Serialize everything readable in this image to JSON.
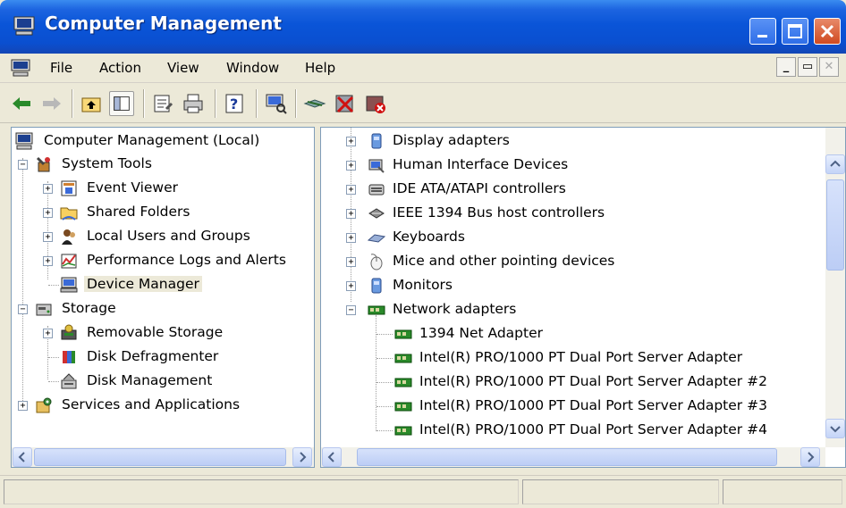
{
  "window": {
    "title": "Computer Management"
  },
  "menu": {
    "items": [
      "File",
      "Action",
      "View",
      "Window",
      "Help"
    ]
  },
  "toolbar": {
    "buttons": [
      "back-arrow",
      "forward-arrow",
      "up-folder",
      "show-hide-tree",
      "properties",
      "print",
      "help",
      "scan-hardware",
      "disable-device",
      "uninstall-device",
      "update-driver"
    ]
  },
  "left_tree": {
    "items": [
      {
        "label": "Computer Management (Local)",
        "icon": "computer-icon"
      },
      {
        "label": "System Tools",
        "icon": "tools-icon"
      },
      {
        "label": "Event Viewer",
        "icon": "event-viewer-icon"
      },
      {
        "label": "Shared Folders",
        "icon": "shared-folder-icon"
      },
      {
        "label": "Local Users and Groups",
        "icon": "users-icon"
      },
      {
        "label": "Performance Logs and Alerts",
        "icon": "performance-icon"
      },
      {
        "label": "Device Manager",
        "icon": "device-manager-icon",
        "selected": true
      },
      {
        "label": "Storage",
        "icon": "storage-icon"
      },
      {
        "label": "Removable Storage",
        "icon": "removable-storage-icon"
      },
      {
        "label": "Disk Defragmenter",
        "icon": "defrag-icon"
      },
      {
        "label": "Disk Management",
        "icon": "disk-management-icon"
      },
      {
        "label": "Services and Applications",
        "icon": "services-icon"
      }
    ]
  },
  "right_tree": {
    "items": [
      {
        "label": "Display adapters",
        "icon": "display-adapter-icon"
      },
      {
        "label": "Human Interface Devices",
        "icon": "hid-icon"
      },
      {
        "label": "IDE ATA/ATAPI controllers",
        "icon": "ide-controller-icon"
      },
      {
        "label": "IEEE 1394 Bus host controllers",
        "icon": "firewire-icon"
      },
      {
        "label": "Keyboards",
        "icon": "keyboard-icon"
      },
      {
        "label": "Mice and other pointing devices",
        "icon": "mouse-icon"
      },
      {
        "label": "Monitors",
        "icon": "monitor-icon"
      },
      {
        "label": "Network adapters",
        "icon": "network-adapter-icon"
      },
      {
        "label": "1394 Net Adapter",
        "icon": "network-card-icon"
      },
      {
        "label": "Intel(R) PRO/1000 PT Dual Port Server Adapter",
        "icon": "network-card-icon"
      },
      {
        "label": "Intel(R) PRO/1000 PT Dual Port Server Adapter #2",
        "icon": "network-card-icon"
      },
      {
        "label": "Intel(R) PRO/1000 PT Dual Port Server Adapter #3",
        "icon": "network-card-icon"
      },
      {
        "label": "Intel(R) PRO/1000 PT Dual Port Server Adapter #4",
        "icon": "network-card-icon"
      }
    ]
  },
  "colors": {
    "titlebar": "#0a55d8",
    "selection": "#ece9d8",
    "chrome": "#ece9d8"
  }
}
